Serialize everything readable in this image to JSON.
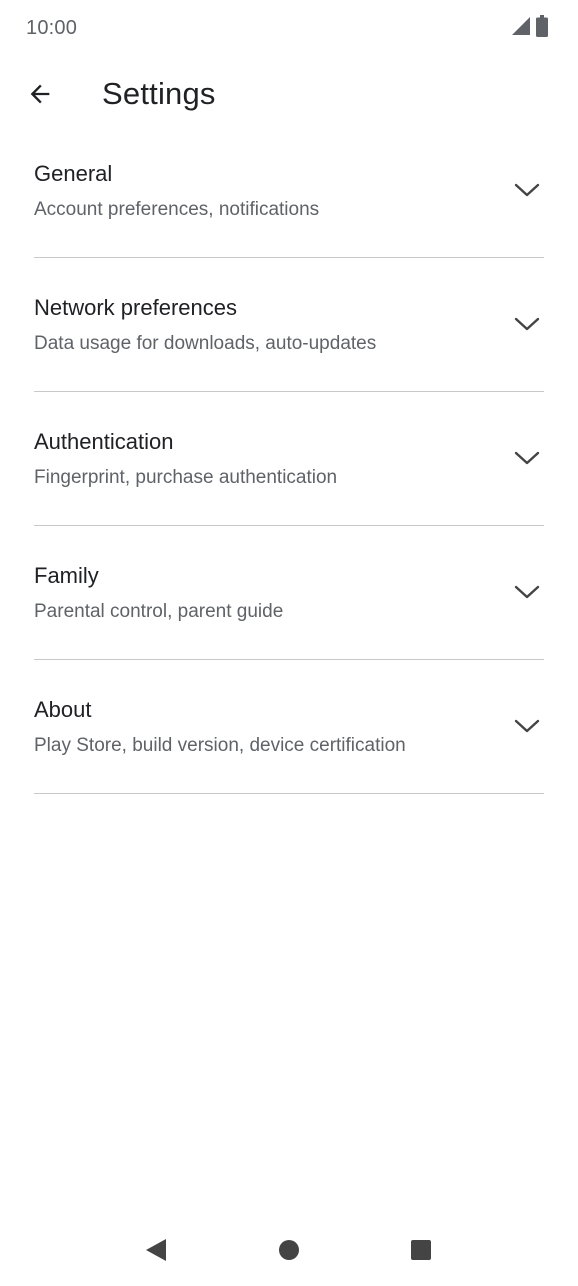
{
  "status_bar": {
    "time": "10:00",
    "icons": [
      "signal-icon",
      "battery-icon"
    ]
  },
  "app_bar": {
    "back_icon": "arrow-back-icon",
    "title": "Settings"
  },
  "settings": {
    "items": [
      {
        "title": "General",
        "subtitle": "Account preferences, notifications",
        "icon": "chevron-down-icon"
      },
      {
        "title": "Network preferences",
        "subtitle": "Data usage for downloads, auto-updates",
        "icon": "chevron-down-icon"
      },
      {
        "title": "Authentication",
        "subtitle": "Fingerprint, purchase authentication",
        "icon": "chevron-down-icon"
      },
      {
        "title": "Family",
        "subtitle": "Parental control, parent guide",
        "icon": "chevron-down-icon"
      },
      {
        "title": "About",
        "subtitle": "Play Store, build version, device certification",
        "icon": "chevron-down-icon"
      }
    ]
  },
  "nav_bar": {
    "buttons": [
      "back-triangle-icon",
      "home-circle-icon",
      "recents-square-icon"
    ]
  },
  "colors": {
    "text_primary": "#202124",
    "text_secondary": "#5f6368",
    "divider": "#c9c9c9",
    "nav_icon": "#444444"
  }
}
